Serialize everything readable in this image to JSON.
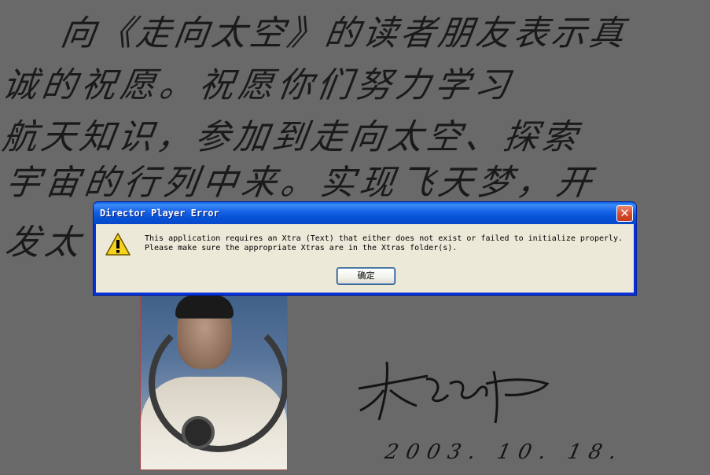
{
  "background_letter": {
    "lines": [
      "向《走向太空》的读者朋友表示真",
      "诚的祝愿。祝愿你们努力学习",
      "航天知识，参加到走向太空、探索",
      "宇宙的行列中来。实现飞天梦，开",
      "发太"
    ],
    "date": "2003. 10. 18."
  },
  "dialog": {
    "title": "Director Player Error",
    "message": "This application requires an Xtra (Text) that either does not exist or failed to initialize properly.\nPlease make sure the appropriate Xtras are in the Xtras folder(s).",
    "ok_label": "确定",
    "icon": "warning-icon",
    "close_icon": "close-icon"
  },
  "colors": {
    "titlebar": "#0553d8",
    "dialog_body": "#ece9d8",
    "close_button": "#d9472a",
    "page_background": "#696969"
  }
}
